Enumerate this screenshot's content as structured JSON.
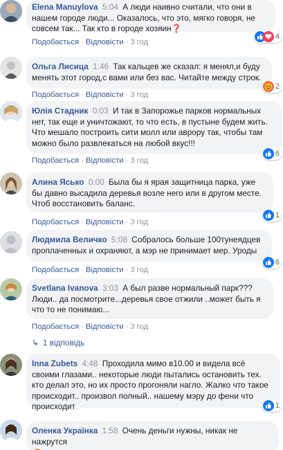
{
  "actions": {
    "like": "Подобається",
    "reply": "Відповісти"
  },
  "comments": [
    {
      "author": "Elena Manuylova",
      "time": "5:04",
      "text": "А люди наивно считали, что они в нашем городе люди... Оказалось, что это, мягко говоря, не совсем так... Так кто в городе хозяин❓",
      "ago": "3 год",
      "reactions": {
        "icons": [
          "like-icon",
          "heart-icon"
        ],
        "count": "4"
      }
    },
    {
      "author": "Ольга Лисица",
      "time": "1:46",
      "text": "Так кальцев же сказал: я менял,и буду менять этот город,с вами или без вас. Читайте между строк.",
      "ago": "3 год",
      "reactions": {
        "icons": [
          "angry-icon"
        ],
        "count": "2"
      }
    },
    {
      "author": "Юлія Стадник",
      "time": "0:03",
      "text": "И так в Запорожье парков нормальных нет, так еще и уничтожают, то что есть, в пустыне будем жить. Что мешало построить сити молл или аврору так, чтобы там можно было развлекаться на любой вкус!!!",
      "ago": "3 год",
      "reactions": {
        "icons": [
          "like-icon"
        ],
        "count": "6"
      }
    },
    {
      "author": "Алина Ясько",
      "time": "0:00",
      "text": "Была бы я ярая защитница парка, уже бы давно высадила деревья возле него или в другом месте. Чтоб восстановить баланс.",
      "ago": "3 год",
      "reactions": {
        "icons": [
          "like-icon"
        ],
        "count": "1"
      }
    },
    {
      "author": "Людмила Величко",
      "time": "5:08",
      "text": "Собралось больше 100тунеядцев проплаченных и охраняют, а мэр не принимает мер. Уроды",
      "ago": "3 год",
      "reactions": {
        "icons": [
          "like-icon"
        ],
        "count": "6"
      }
    },
    {
      "author": "Svetlana Ivanova",
      "time": "3:03",
      "text": "А был разве нормальный парк??? Люди.. да посмотрите...деревья свое отжили ..может быть я что то не понимаю...",
      "ago": "3 год",
      "reactions": {
        "icons": [],
        "count": ""
      },
      "replies": "1 відповідь"
    },
    {
      "author": "Inna Zubets",
      "time": "4:48",
      "text": "Проходила мимо в10.00 и видела всё своими глазами.. некоторые люди пытались остановить тех. кто делал это, но их просто прогоняли нагло. Жалко что такое происходит.. произвол полный.. нашему мэру до фени что происходит",
      "ago": "",
      "reactions": {
        "icons": [
          "like-icon"
        ],
        "count": "1"
      }
    },
    {
      "author": "Оленка Українка",
      "time": "1:58",
      "text": "Очень деньги нужны, никак не нажрутся",
      "emoji": "angry-emoji-icon",
      "ago": "",
      "reactions": {
        "icons": [],
        "count": ""
      }
    }
  ]
}
